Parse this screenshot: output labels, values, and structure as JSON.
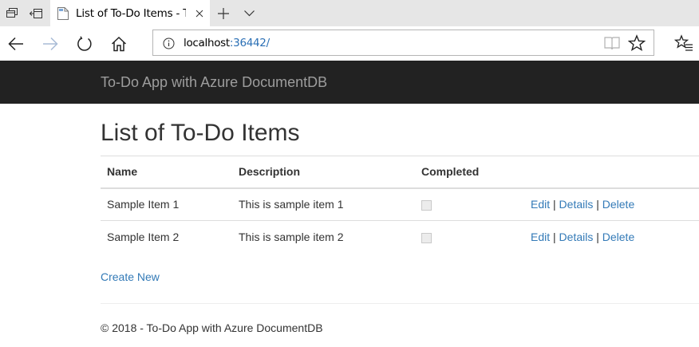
{
  "browser": {
    "tab": {
      "title": "List of To-Do Items - To-Do App with Azure DocumentDB"
    },
    "address": {
      "host": "localhost",
      "port": ":36442/"
    }
  },
  "navbar": {
    "brand": "To-Do App with Azure DocumentDB"
  },
  "main": {
    "heading": "List of To-Do Items",
    "table": {
      "headers": {
        "name": "Name",
        "description": "Description",
        "completed": "Completed"
      },
      "rows": [
        {
          "name": "Sample Item 1",
          "description": "This is sample item 1",
          "completed": false
        },
        {
          "name": "Sample Item 2",
          "description": "This is sample item 2",
          "completed": false
        }
      ],
      "actions": {
        "edit": "Edit",
        "details": "Details",
        "delete": "Delete",
        "separator": "|"
      }
    },
    "create_new": "Create New"
  },
  "footer": {
    "text": "© 2018 - To-Do App with Azure DocumentDB"
  },
  "colors": {
    "navbar_bg": "#222222",
    "brand_text": "#9d9d9d",
    "link": "#337ab7",
    "text": "#333333",
    "tab_strip": "#e6e6e6"
  },
  "icons": [
    "tab-preview-icon",
    "set-tabs-aside-icon",
    "page-favicon",
    "tab-close-icon",
    "new-tab-icon",
    "tab-list-chevron-icon",
    "back-arrow-icon",
    "forward-arrow-icon",
    "refresh-icon",
    "home-icon",
    "site-info-icon",
    "reading-view-icon",
    "favorite-star-icon",
    "favorites-hub-icon"
  ]
}
